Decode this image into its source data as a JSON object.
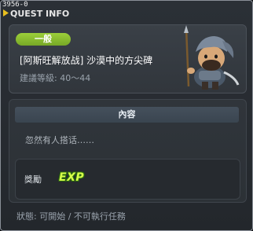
{
  "window": {
    "id_code": "3956-0",
    "title": "QUEST INFO"
  },
  "quest": {
    "type_label": "一般",
    "name": "[阿斯旺解放战] 沙漠中的方尖碑",
    "level": "建議等級: 40～44"
  },
  "content": {
    "header": "內容",
    "text": "忽然有人搭话……"
  },
  "reward": {
    "label": "獎勵",
    "exp": "EXP"
  },
  "status": "狀態: 可開始 / 不可執行任務",
  "icons": {
    "npc": "desert-guard-portrait",
    "title_arrow": "yellow-arrow-icon"
  },
  "colors": {
    "type_pill": "#8cc43a",
    "exp_text": "#d8ff4a",
    "title_arrow": "#e8c020"
  }
}
